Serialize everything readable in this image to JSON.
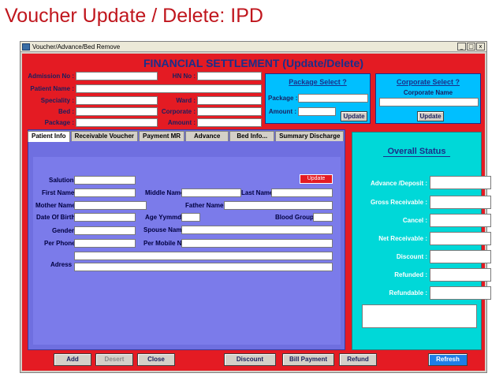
{
  "slide": {
    "title": "Voucher Update / Delete: IPD"
  },
  "window": {
    "title": "Voucher/Advance/Bed Remove",
    "min": "_",
    "max": "□",
    "close": "x"
  },
  "header": {
    "title": "FINANCIAL SETTLEMENT (Update/Delete)"
  },
  "top_form": {
    "admission_no": "Admission No :",
    "hn_no": "HN No :",
    "patient_name": "Patient Name :",
    "speciality": "Speciality :",
    "ward": "Ward :",
    "bed": "Bed :",
    "corporate": "Corporate :",
    "package": "Package :",
    "amount": "Amount :"
  },
  "package_box": {
    "title": "Package Select ?",
    "package_label": "Package :",
    "amount_label": "Amount :",
    "update": "Update"
  },
  "corporate_box": {
    "title": "Corporate Select ?",
    "name_label": "Corporate Name",
    "update": "Update"
  },
  "tabs": [
    "Patient Info",
    "Receivable Voucher",
    "Payment MR",
    "Advance",
    "Bed Info...",
    "Summary Discharge"
  ],
  "patient_form": {
    "salution": "Salution",
    "update": "Update",
    "first_name": "First Name",
    "middle_name": "Middle Name",
    "last_name": "Last Name",
    "mother_name": "Mother Name",
    "father_name": "Father Name",
    "dob": "Date Of Birth",
    "age": "Age Yymmdd",
    "blood_group": "Blood Group",
    "gender": "Gender",
    "spouse_name": "Spouse Name",
    "per_phone": "Per Phone",
    "per_mobile": "Per Mobile No",
    "adress": "Adress"
  },
  "status": {
    "title": "Overall Status",
    "advance": "Advance /Deposit :",
    "gross": "Gross Receivable :",
    "cancel": "Cancel :",
    "net": "Net Receivable :",
    "discount": "Discount :",
    "refunded": "Refunded :",
    "refundable": "Refundable :"
  },
  "buttons": {
    "add": "Add",
    "desert": "Desert",
    "close": "Close",
    "discount": "Discount",
    "bill_payment": "Bill Payment",
    "refund": "Refund",
    "refresh": "Refresh"
  }
}
